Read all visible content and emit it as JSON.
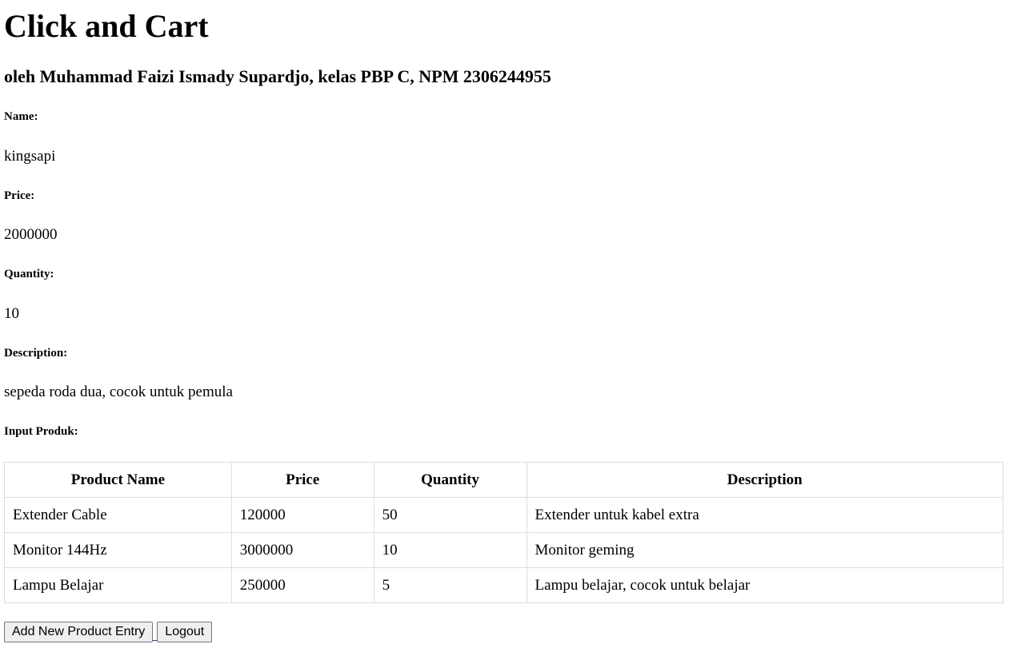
{
  "header": {
    "title": "Click and Cart",
    "subtitle": "oleh Muhammad Faizi Ismady Supardjo, kelas PBP C, NPM 2306244955"
  },
  "fields": {
    "name_label": "Name:",
    "name_value": "kingsapi",
    "price_label": "Price:",
    "price_value": "2000000",
    "quantity_label": "Quantity:",
    "quantity_value": "10",
    "description_label": "Description:",
    "description_value": "sepeda roda dua, cocok untuk pemula",
    "input_label": "Input Produk:"
  },
  "table": {
    "headers": [
      "Product Name",
      "Price",
      "Quantity",
      "Description"
    ],
    "rows": [
      [
        "Extender Cable",
        "120000",
        "50",
        "Extender untuk kabel extra"
      ],
      [
        "Monitor 144Hz",
        "3000000",
        "10",
        "Monitor geming"
      ],
      [
        "Lampu Belajar",
        "250000",
        "5",
        "Lampu belajar, cocok untuk belajar"
      ]
    ]
  },
  "actions": {
    "add_label": "Add New Product Entry",
    "logout_label": "Logout"
  }
}
